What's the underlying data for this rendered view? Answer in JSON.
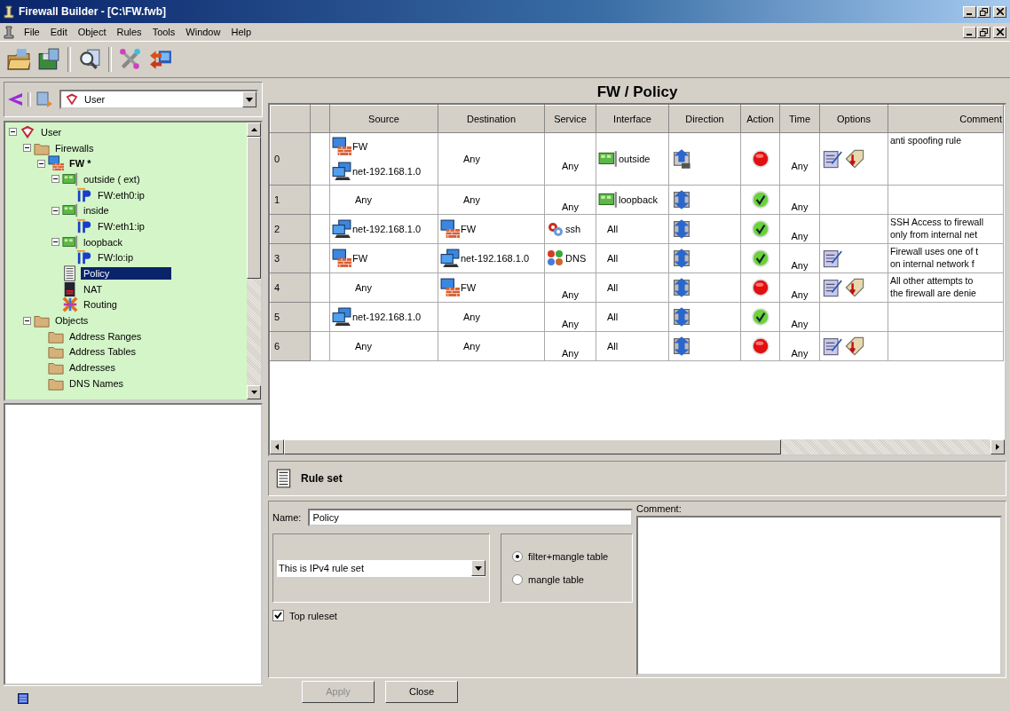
{
  "window": {
    "title": "Firewall Builder - [C:\\FW.fwb]"
  },
  "menu": [
    "File",
    "Edit",
    "Object",
    "Rules",
    "Tools",
    "Window",
    "Help"
  ],
  "toolbar": [
    {
      "kind": "open"
    },
    {
      "kind": "save"
    },
    {
      "kind": "find"
    },
    {
      "kind": "compile"
    },
    {
      "kind": "install"
    }
  ],
  "library": {
    "value": "User"
  },
  "tree": [
    {
      "label": "User",
      "kind": "library",
      "expanded": true,
      "selected": false,
      "children": [
        {
          "label": "Firewalls",
          "kind": "folder",
          "expanded": true,
          "selected": false,
          "children": [
            {
              "label": "FW *",
              "kind": "firewall",
              "expanded": true,
              "selected": false,
              "children": [
                {
                  "label": "outside ( ext)",
                  "kind": "interface",
                  "expanded": true,
                  "selected": false,
                  "children": [
                    {
                      "label": "FW:eth0:ip",
                      "kind": "address",
                      "selected": false
                    }
                  ]
                },
                {
                  "label": "inside",
                  "kind": "interface",
                  "expanded": true,
                  "selected": false,
                  "children": [
                    {
                      "label": "FW:eth1:ip",
                      "kind": "address",
                      "selected": false
                    }
                  ]
                },
                {
                  "label": "loopback",
                  "kind": "interface",
                  "expanded": true,
                  "selected": false,
                  "children": [
                    {
                      "label": "FW:lo:ip",
                      "kind": "address",
                      "selected": false
                    }
                  ]
                },
                {
                  "label": "Policy",
                  "kind": "policy",
                  "selected": true
                },
                {
                  "label": "NAT",
                  "kind": "nat",
                  "selected": false
                },
                {
                  "label": "Routing",
                  "kind": "routing",
                  "selected": false
                }
              ]
            }
          ]
        },
        {
          "label": "Objects",
          "kind": "folder",
          "expanded": true,
          "selected": false,
          "children": [
            {
              "label": "Address Ranges",
              "kind": "folder",
              "selected": false
            },
            {
              "label": "Address Tables",
              "kind": "folder",
              "selected": false
            },
            {
              "label": "Addresses",
              "kind": "folder",
              "selected": false
            },
            {
              "label": "DNS Names",
              "kind": "folder",
              "selected": false
            }
          ]
        }
      ]
    }
  ],
  "policy": {
    "title": "FW / Policy",
    "columns": [
      "Source",
      "Destination",
      "Service",
      "Interface",
      "Direction",
      "Action",
      "Time",
      "Options",
      "Comment"
    ],
    "rows": [
      {
        "number": "0",
        "source": [
          {
            "kind": "firewall",
            "label": "FW"
          },
          {
            "kind": "network",
            "label": "net-192.168.1.0"
          }
        ],
        "destination": [
          {
            "kind": "any",
            "label": "Any"
          }
        ],
        "service": {
          "kind": "any",
          "label": "Any"
        },
        "interface": {
          "kind": "interface",
          "label": "outside"
        },
        "direction": {
          "kind": "inbound"
        },
        "action": {
          "kind": "deny"
        },
        "time": "Any",
        "options": [
          {
            "kind": "log"
          },
          {
            "kind": "options"
          }
        ],
        "comment": [
          "anti spoofing rule"
        ]
      },
      {
        "number": "1",
        "source": [
          {
            "kind": "any",
            "label": "Any"
          }
        ],
        "destination": [
          {
            "kind": "any",
            "label": "Any"
          }
        ],
        "service": {
          "kind": "any",
          "label": "Any"
        },
        "interface": {
          "kind": "interface",
          "label": "loopback"
        },
        "direction": {
          "kind": "both"
        },
        "action": {
          "kind": "accept"
        },
        "time": "Any",
        "comment": []
      },
      {
        "number": "2",
        "source": [
          {
            "kind": "network",
            "label": "net-192.168.1.0"
          }
        ],
        "destination": [
          {
            "kind": "firewall",
            "label": "FW"
          }
        ],
        "service": {
          "kind": "tcp",
          "label": "ssh"
        },
        "interface": {
          "kind": "any",
          "label": "All"
        },
        "direction": {
          "kind": "both"
        },
        "action": {
          "kind": "accept"
        },
        "time": "Any",
        "comment": [
          "SSH Access to firewall",
          "only from internal net"
        ]
      },
      {
        "number": "3",
        "source": [
          {
            "kind": "firewall",
            "label": "FW"
          }
        ],
        "destination": [
          {
            "kind": "network",
            "label": "net-192.168.1.0"
          }
        ],
        "service": {
          "kind": "group",
          "label": "DNS"
        },
        "interface": {
          "kind": "any",
          "label": "All"
        },
        "direction": {
          "kind": "both"
        },
        "action": {
          "kind": "accept"
        },
        "time": "Any",
        "options": [
          {
            "kind": "log"
          }
        ],
        "comment": [
          "Firewall uses one of t",
          "on internal network f"
        ]
      },
      {
        "number": "4",
        "source": [
          {
            "kind": "any",
            "label": "Any"
          }
        ],
        "destination": [
          {
            "kind": "firewall",
            "label": "FW"
          }
        ],
        "service": {
          "kind": "any",
          "label": "Any"
        },
        "interface": {
          "kind": "any",
          "label": "All"
        },
        "direction": {
          "kind": "both"
        },
        "action": {
          "kind": "deny"
        },
        "time": "Any",
        "options": [
          {
            "kind": "log"
          },
          {
            "kind": "options"
          }
        ],
        "comment": [
          "All other attempts to",
          "the firewall are denie"
        ]
      },
      {
        "number": "5",
        "source": [
          {
            "kind": "network",
            "label": "net-192.168.1.0"
          }
        ],
        "destination": [
          {
            "kind": "any",
            "label": "Any"
          }
        ],
        "service": {
          "kind": "any",
          "label": "Any"
        },
        "interface": {
          "kind": "any",
          "label": "All"
        },
        "direction": {
          "kind": "both"
        },
        "action": {
          "kind": "accept"
        },
        "time": "Any"
      },
      {
        "number": "6",
        "source": [
          {
            "kind": "any",
            "label": "Any"
          }
        ],
        "destination": [
          {
            "kind": "any",
            "label": "Any"
          }
        ],
        "service": {
          "kind": "any",
          "label": "Any"
        },
        "interface": {
          "kind": "any",
          "label": "All"
        },
        "direction": {
          "kind": "both"
        },
        "action": {
          "kind": "deny"
        },
        "time": "Any",
        "options": [
          {
            "kind": "log"
          },
          {
            "kind": "options"
          }
        ]
      }
    ]
  },
  "editor": {
    "title": "Rule set",
    "name_label": "Name:",
    "name": "Policy",
    "comment_label": "Comment:",
    "ip_version": "This is IPv4 rule set",
    "tables": [
      {
        "label": "filter+mangle table",
        "selected": true
      },
      {
        "label": "mangle table",
        "selected": false
      }
    ],
    "top_ruleset": {
      "label": "Top ruleset",
      "checked": true
    }
  },
  "buttons": [
    {
      "label": "Apply",
      "disabled": true
    },
    {
      "label": "Close",
      "disabled": false
    }
  ]
}
